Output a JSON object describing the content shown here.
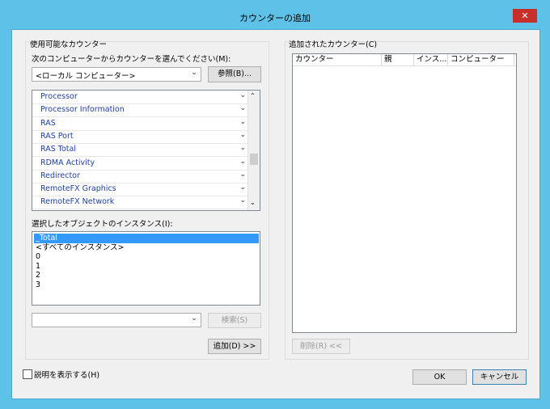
{
  "window": {
    "title": "カウンターの追加",
    "close_glyph": "✕"
  },
  "left": {
    "group_label": "使用可能なカウンター",
    "computer_label": "次のコンピューターからカウンターを選んでください(M):",
    "computer_value": "<ローカル コンピューター>",
    "browse_button": "参照(B)...",
    "objects": [
      "Processor",
      "Processor Information",
      "RAS",
      "RAS Port",
      "RAS Total",
      "RDMA Activity",
      "Redirector",
      "RemoteFX Graphics",
      "RemoteFX Network"
    ],
    "instances_label": "選択したオブジェクトのインスタンス(I):",
    "instances": [
      "_Total",
      "<すべてのインスタンス>",
      "0",
      "1",
      "2",
      "3"
    ],
    "search_value": "",
    "search_button": "検索(S)",
    "add_button": "追加(D) >>"
  },
  "right": {
    "group_label": "追加されたカウンター(C)",
    "columns": [
      "カウンター",
      "親",
      "インス...",
      "コンピューター"
    ],
    "remove_button": "削除(R) <<"
  },
  "footer": {
    "show_description": "説明を表示する(H)",
    "ok_button": "OK",
    "cancel_button": "キャンセル"
  }
}
